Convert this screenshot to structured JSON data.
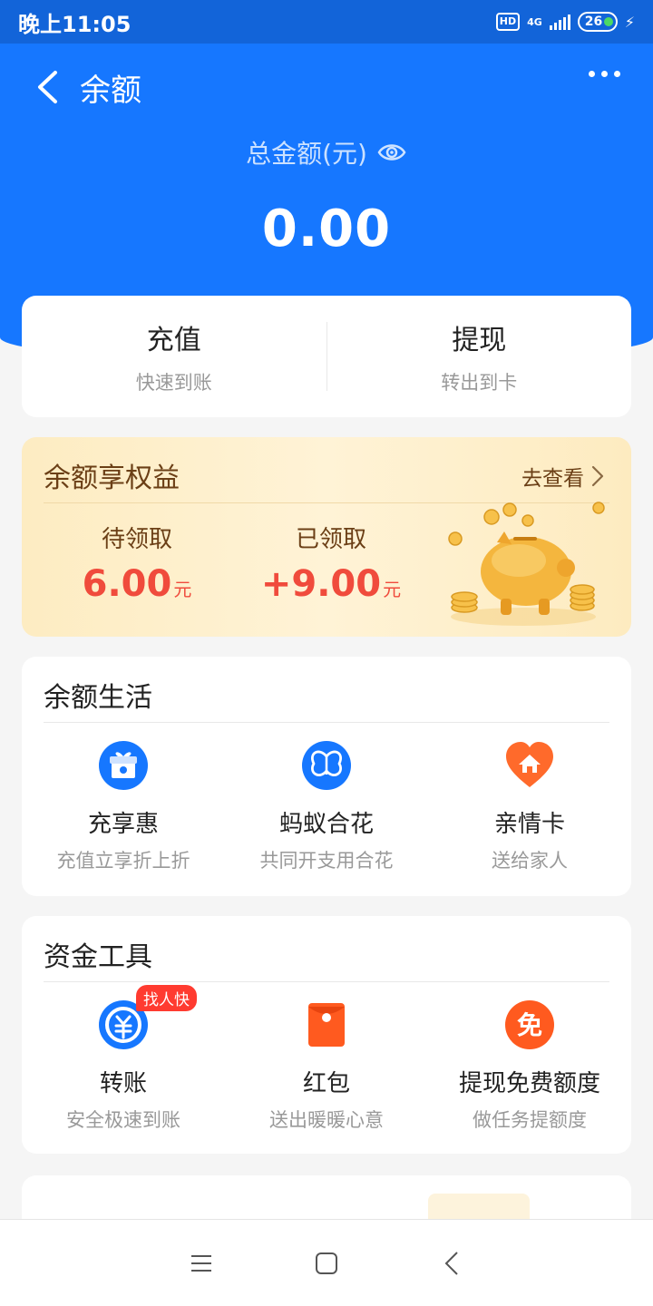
{
  "status_bar": {
    "time": "晚上11:05",
    "network_badge": "HD",
    "network_type": "4G",
    "battery_level": "26"
  },
  "header": {
    "title": "余额"
  },
  "balance": {
    "label": "总金额(元)",
    "amount": "0.00"
  },
  "actions": [
    {
      "title": "充值",
      "subtitle": "快速到账"
    },
    {
      "title": "提现",
      "subtitle": "转出到卡"
    }
  ],
  "benefits": {
    "title": "余额享权益",
    "link": "去查看",
    "pending_label": "待领取",
    "pending_value": "6.00",
    "received_label": "已领取",
    "received_value": "+9.00",
    "unit": "元"
  },
  "life_section": {
    "title": "余额生活",
    "items": [
      {
        "label": "充享惠",
        "subtitle": "充值立享折上折",
        "icon": "gift-icon"
      },
      {
        "label": "蚂蚁合花",
        "subtitle": "共同开支用合花",
        "icon": "butterfly-icon"
      },
      {
        "label": "亲情卡",
        "subtitle": "送给家人",
        "icon": "heart-home-icon"
      }
    ]
  },
  "fund_section": {
    "title": "资金工具",
    "items": [
      {
        "label": "转账",
        "subtitle": "安全极速到账",
        "icon": "transfer-icon",
        "tag": "找人快"
      },
      {
        "label": "红包",
        "subtitle": "送出暖暖心意",
        "icon": "red-packet-icon"
      },
      {
        "label": "提现免费额度",
        "subtitle": "做任务提额度",
        "icon": "free-icon",
        "icon_text": "免"
      }
    ]
  },
  "colors": {
    "primary": "#1677ff",
    "accent_red": "#f04b3c",
    "benefit_text": "#6b3f16"
  }
}
